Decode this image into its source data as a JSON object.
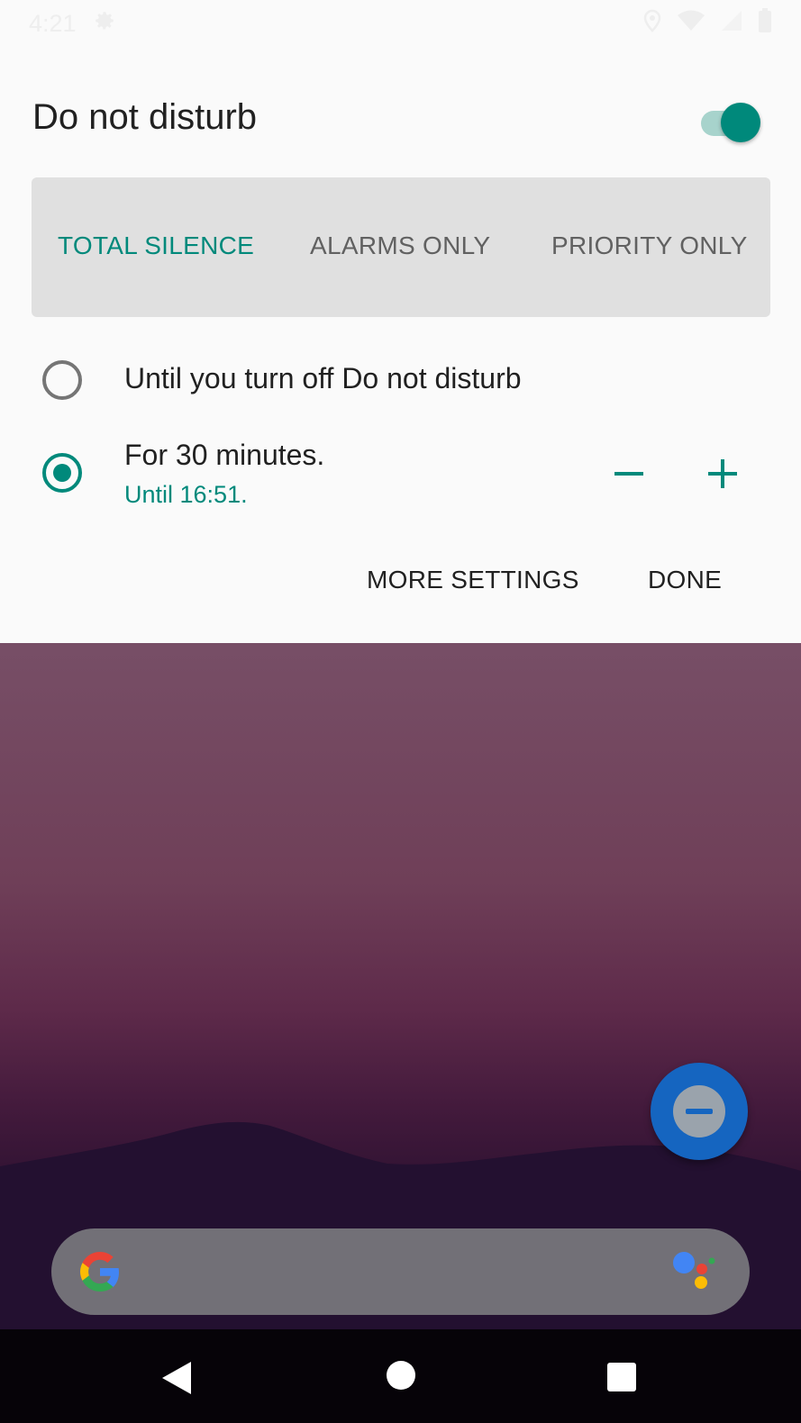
{
  "status_bar": {
    "time": "4:21",
    "icons": [
      "gear-icon",
      "location-icon",
      "wifi-icon",
      "signal-icon",
      "battery-icon"
    ]
  },
  "dnd": {
    "title": "Do not disturb",
    "enabled": true,
    "modes": [
      {
        "label": "TOTAL SILENCE",
        "selected": true
      },
      {
        "label": "ALARMS ONLY",
        "selected": false
      },
      {
        "label": "PRIORITY ONLY",
        "selected": false
      }
    ],
    "options": [
      {
        "label": "Until you turn off Do not disturb",
        "selected": false
      },
      {
        "label": "For 30 minutes.",
        "sublabel": "Until 16:51.",
        "selected": true
      }
    ],
    "actions": {
      "more_settings": "MORE SETTINGS",
      "done": "DONE"
    }
  },
  "home": {
    "fab_icon": "dnd-minus-icon",
    "search_icons": [
      "google-g-icon",
      "assistant-icon"
    ]
  },
  "nav": [
    "back-icon",
    "home-icon",
    "recents-icon"
  ],
  "colors": {
    "accent": "#00897b",
    "panel": "#fafafa",
    "mode_bar": "#e0e0e0",
    "fab": "#1565c0"
  }
}
